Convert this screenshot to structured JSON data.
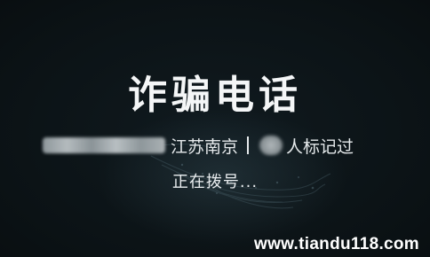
{
  "call": {
    "title": "诈骗电话",
    "location": "江苏南京",
    "separator": "|",
    "marked_label": "人标记过",
    "status": "正在拨号..."
  },
  "watermark": "www.tiandu118.com"
}
